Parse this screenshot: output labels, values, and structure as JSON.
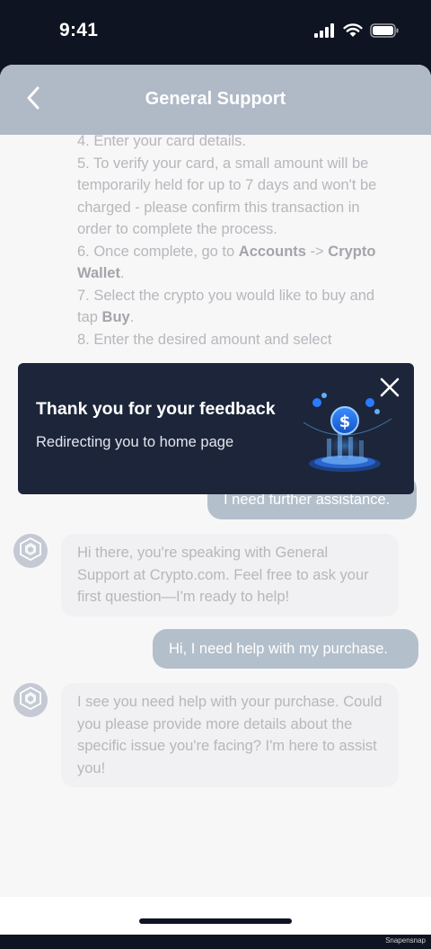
{
  "status_bar": {
    "time": "9:41"
  },
  "header": {
    "title": "General Support"
  },
  "messages": {
    "agent_top": {
      "line4": "4. Enter your card details.",
      "line5": "5. To verify your card, a small amount will be temporarily held for up to 7 days and won't be charged - please confirm this transaction in order to complete the process.",
      "line6_prefix": "6. Once complete, go to ",
      "line6_accounts": "Accounts",
      "line6_arrow": " -> ",
      "line6_wallet": "Crypto Wallet",
      "line6_suffix": ".",
      "line7_prefix": "7. Select the crypto you would like to buy and tap ",
      "line7_buy": "Buy",
      "line7_suffix": ".",
      "line8": "8. Enter the desired amount and select"
    },
    "user_1": "I need further assistance.",
    "agent_2": "Hi there, you're speaking with General Support at Crypto.com. Feel free to ask your first question—I'm ready to help!",
    "user_2": "Hi, I need help with my purchase.",
    "agent_3": "I see you need help with your purchase. Could you please provide more details about the specific issue you're facing? I'm here to assist you!"
  },
  "toast": {
    "title": "Thank you for your feedback",
    "subtitle": "Redirecting you to home page"
  },
  "watermark": "Snapensnap",
  "colors": {
    "header": "#b0b9c6",
    "user_bubble": "#b3bfcb",
    "toast_bg": "#1c2539",
    "background": "#f7f7f8",
    "accent_blue": "#2a7bff"
  }
}
